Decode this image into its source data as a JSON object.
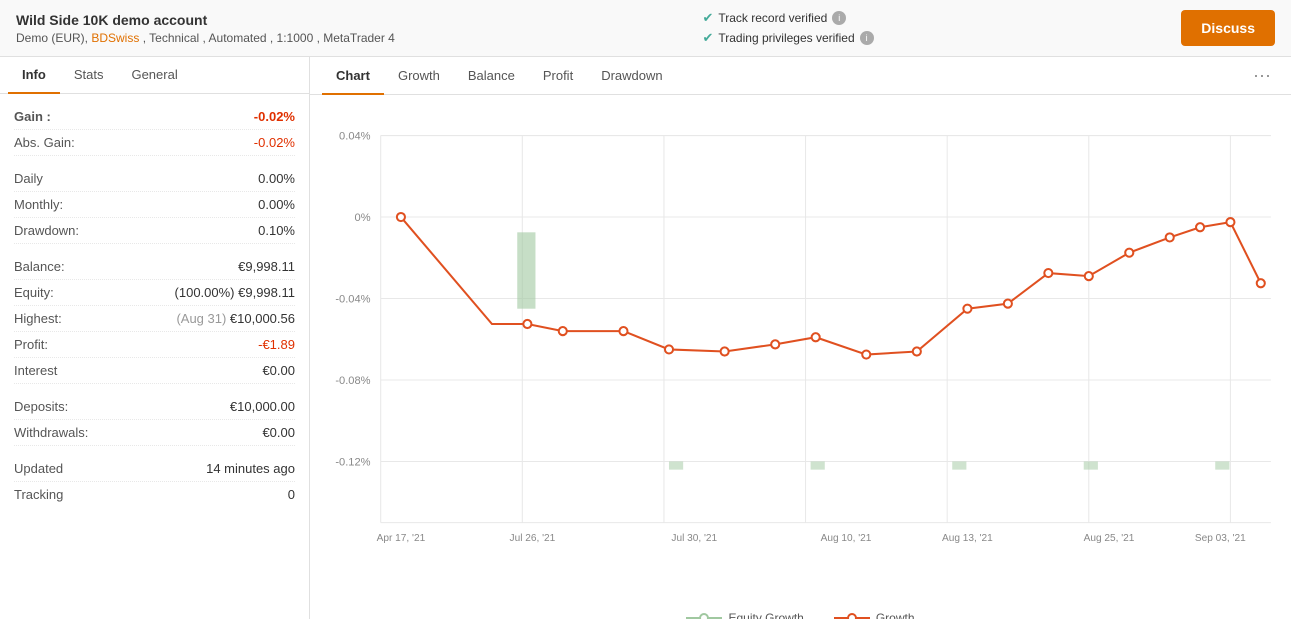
{
  "header": {
    "title": "Wild Side 10K demo account",
    "subtitle": "Demo (EUR), BDSwiss , Technical , Automated , 1:1000 , MetaTrader 4",
    "bdswiss_link": "BDSwiss",
    "track_record": "Track record verified",
    "trading_privileges": "Trading privileges verified",
    "discuss_label": "Discuss"
  },
  "left_tabs": [
    {
      "label": "Info",
      "active": true
    },
    {
      "label": "Stats",
      "active": false
    },
    {
      "label": "General",
      "active": false
    }
  ],
  "info_rows": [
    {
      "label": "Gain :",
      "value": "-0.02%",
      "type": "negative",
      "bold": true
    },
    {
      "label": "Abs. Gain:",
      "value": "-0.02%",
      "type": "negative",
      "bold": false
    },
    {
      "label": "Daily",
      "value": "0.00%",
      "type": "normal",
      "bold": false
    },
    {
      "label": "Monthly:",
      "value": "0.00%",
      "type": "normal",
      "bold": false
    },
    {
      "label": "Drawdown:",
      "value": "0.10%",
      "type": "normal",
      "bold": false
    },
    {
      "label": "Balance:",
      "value": "€9,998.11",
      "type": "normal",
      "bold": false
    },
    {
      "label": "Equity:",
      "value": "(100.00%) €9,998.11",
      "type": "normal",
      "bold": false
    },
    {
      "label": "Highest:",
      "value_muted": "Aug 31",
      "value": "€10,000.56",
      "type": "normal",
      "bold": false
    },
    {
      "label": "Profit:",
      "value": "-€1.89",
      "type": "negative",
      "bold": false
    },
    {
      "label": "Interest",
      "value": "€0.00",
      "type": "normal",
      "bold": false
    },
    {
      "label": "Deposits:",
      "value": "€10,000.00",
      "type": "normal",
      "bold": false
    },
    {
      "label": "Withdrawals:",
      "value": "€0.00",
      "type": "normal",
      "bold": false
    },
    {
      "label": "Updated",
      "value": "14 minutes ago",
      "type": "normal",
      "bold": false
    },
    {
      "label": "Tracking",
      "value": "0",
      "type": "normal",
      "bold": false
    }
  ],
  "chart_tabs": [
    {
      "label": "Chart",
      "active": true
    },
    {
      "label": "Growth",
      "active": false
    },
    {
      "label": "Balance",
      "active": false
    },
    {
      "label": "Profit",
      "active": false
    },
    {
      "label": "Drawdown",
      "active": false
    }
  ],
  "chart": {
    "y_labels": [
      "0.04%",
      "0%",
      "-0.04%",
      "-0.08%",
      "-0.12%"
    ],
    "x_labels": [
      "Apr 17, '21",
      "Jul 26, '21",
      "Jul 30, '21",
      "Aug 10, '21",
      "Aug 13, '21",
      "Aug 25, '21",
      "Sep 03, '21"
    ],
    "legend": {
      "equity_growth_label": "Equity Growth",
      "growth_label": "Growth",
      "equity_color": "#8FBC8F",
      "growth_color": "#e05020"
    }
  }
}
